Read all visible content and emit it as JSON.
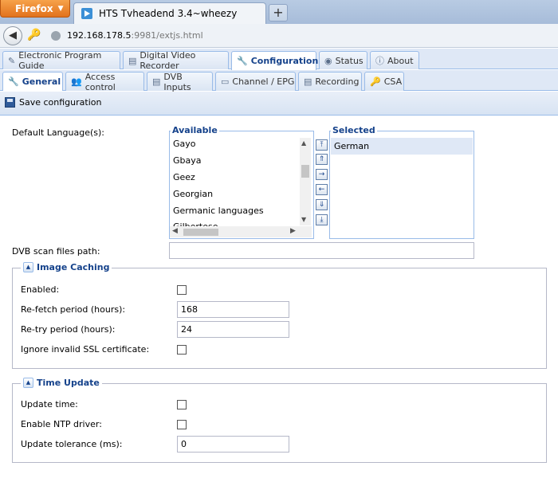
{
  "browser": {
    "menu_label": "Firefox",
    "tab_title": "HTS Tvheadend 3.4~wheezy",
    "new_tab": "+",
    "url_host": "192.168.178.5",
    "url_rest": ":9981/extjs.html"
  },
  "app_tabs": [
    {
      "label": "Electronic Program Guide",
      "icon": "tag-icon"
    },
    {
      "label": "Digital Video Recorder",
      "icon": "film-icon"
    },
    {
      "label": "Configuration",
      "icon": "wrench-icon"
    },
    {
      "label": "Status",
      "icon": "eye-icon"
    },
    {
      "label": "About",
      "icon": "info-icon"
    }
  ],
  "sub_tabs": [
    {
      "label": "General",
      "icon": "wrench-icon"
    },
    {
      "label": "Access control",
      "icon": "users-icon"
    },
    {
      "label": "DVB Inputs",
      "icon": "film-icon"
    },
    {
      "label": "Channel / EPG",
      "icon": "tv-icon"
    },
    {
      "label": "Recording",
      "icon": "film-icon"
    },
    {
      "label": "CSA",
      "icon": "key-icon"
    }
  ],
  "toolbar": {
    "save_label": "Save configuration"
  },
  "general": {
    "default_language_label": "Default Language(s):",
    "available_title": "Available",
    "selected_title": "Selected",
    "available_items": [
      "Gayo",
      "Gbaya",
      "Geez",
      "Georgian",
      "Germanic languages",
      "Gilbertese"
    ],
    "selected_items": [
      "German"
    ],
    "dvb_scan_path_label": "DVB scan files path:",
    "dvb_scan_path_value": ""
  },
  "image_caching": {
    "title": "Image Caching",
    "enabled_label": "Enabled:",
    "enabled": false,
    "refetch_label": "Re-fetch period (hours):",
    "refetch_value": "168",
    "retry_label": "Re-try period (hours):",
    "retry_value": "24",
    "ignore_ssl_label": "Ignore invalid SSL certificate:",
    "ignore_ssl": false
  },
  "time_update": {
    "title": "Time Update",
    "update_time_label": "Update time:",
    "update_time": false,
    "ntp_label": "Enable NTP driver:",
    "ntp": false,
    "tolerance_label": "Update tolerance (ms):",
    "tolerance_value": "0"
  },
  "colors": {
    "accent": "#15428b",
    "tab_border": "#99bbe8",
    "tab_bg": "#dfe8f6",
    "firefox": "#e2721c"
  }
}
